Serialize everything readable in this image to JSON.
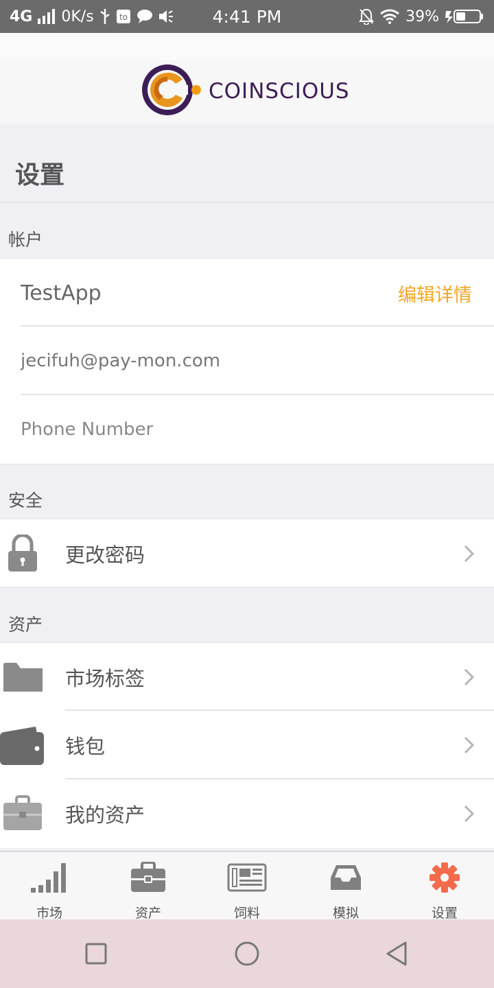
{
  "status_bar": {
    "network": "4G",
    "speed": "0K/s",
    "time": "4:41 PM",
    "battery": "39%"
  },
  "brand": {
    "name": "COINSCIOUS",
    "colors": {
      "ring": "#3d1d55",
      "accent": "#f39c12"
    }
  },
  "page": {
    "title": "设置"
  },
  "account": {
    "header": "帐户",
    "name": "TestApp",
    "edit_label": "编辑详情",
    "email": "jecifuh@pay-mon.com",
    "phone_placeholder": "Phone Number"
  },
  "security": {
    "header": "安全",
    "items": [
      {
        "label": "更改密码",
        "icon": "lock-icon"
      }
    ]
  },
  "assets": {
    "header": "资产",
    "items": [
      {
        "label": "市场标签",
        "icon": "folder-icon"
      },
      {
        "label": "钱包",
        "icon": "wallet-icon"
      },
      {
        "label": "我的资产",
        "icon": "briefcase-icon"
      }
    ]
  },
  "tabs": [
    {
      "label": "市场",
      "icon": "bar-chart-icon"
    },
    {
      "label": "资产",
      "icon": "briefcase-icon"
    },
    {
      "label": "饲料",
      "icon": "newspaper-icon"
    },
    {
      "label": "模拟",
      "icon": "inbox-icon"
    },
    {
      "label": "设置",
      "icon": "gear-icon",
      "active": true
    }
  ],
  "colors": {
    "accent": "#f5a623",
    "active_tab": "#f26b4b",
    "icon_gray": "#808080"
  }
}
